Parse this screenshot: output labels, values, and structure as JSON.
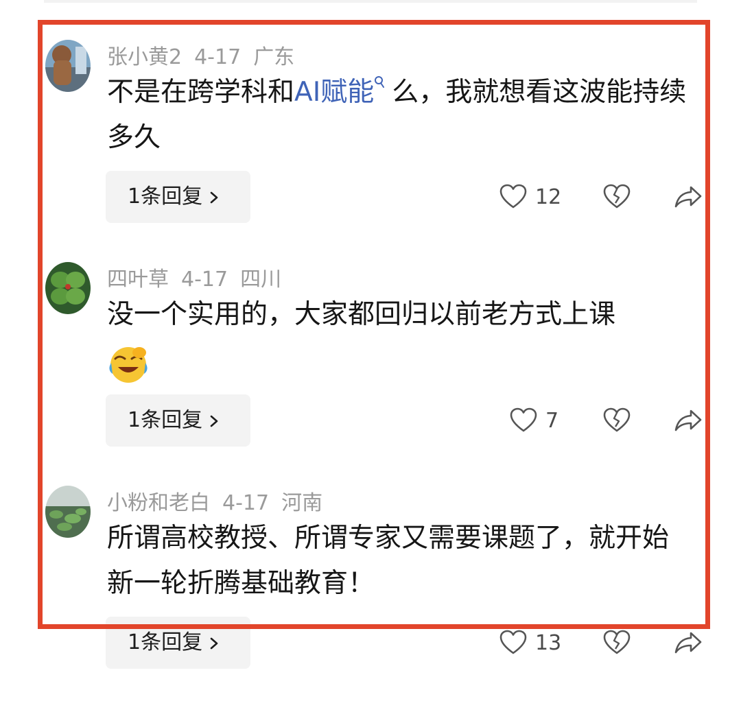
{
  "comments": [
    {
      "user": "张小黄2",
      "date": "4-17",
      "location": "广东",
      "text_before": "不是在跨学科和",
      "highlight": "AI赋能",
      "text_after": "么，我就想看这波能持续多久",
      "reply_label": "1条回复",
      "likes": "12"
    },
    {
      "user": "四叶草",
      "date": "4-17",
      "location": "四川",
      "text": "没一个实用的，大家都回归以前老方式上课",
      "emoji": "laughing-crying-emoji",
      "reply_label": "1条回复",
      "likes": "7"
    },
    {
      "user": "小粉和老白",
      "date": "4-17",
      "location": "河南",
      "text": "所谓高校教授、所谓专家又需要课题了，就开始新一轮折腾基础教育！",
      "reply_label": "1条回复",
      "likes": "13"
    }
  ],
  "colors": {
    "highlight_frame": "#e2452b",
    "link": "#3f63b7",
    "meta": "#9a9a9a"
  }
}
